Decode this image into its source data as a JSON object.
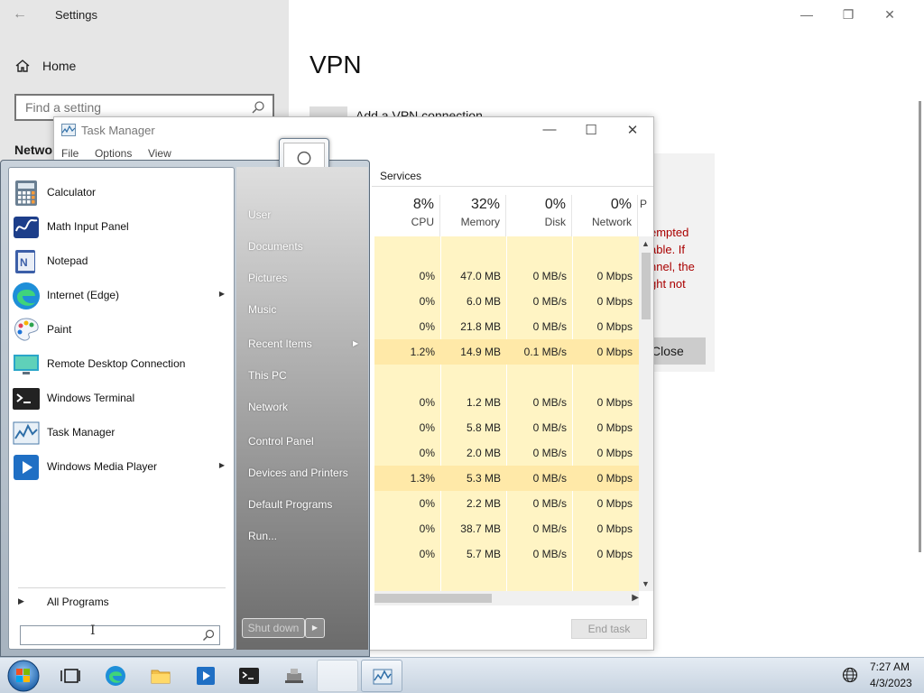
{
  "settings": {
    "title": "Settings",
    "home": "Home",
    "search_placeholder": "Find a setting",
    "section": "Network & Internet",
    "page_title": "VPN",
    "add_vpn": "Add a VPN connection",
    "error_text": "empted\nable. If\nnnel, the\nght not",
    "close_button": "Close"
  },
  "task_manager": {
    "title": "Task Manager",
    "menu": [
      "File",
      "Options",
      "View"
    ],
    "tab_services": "Services",
    "headers": [
      {
        "pct": "8%",
        "name": "CPU"
      },
      {
        "pct": "32%",
        "name": "Memory"
      },
      {
        "pct": "0%",
        "name": "Disk"
      },
      {
        "pct": "0%",
        "name": "Network"
      },
      {
        "pct": "",
        "name": "P"
      }
    ],
    "rows": [
      [
        "",
        "",
        "",
        ""
      ],
      [
        "0%",
        "47.0 MB",
        "0 MB/s",
        "0 Mbps"
      ],
      [
        "0%",
        "6.0 MB",
        "0 MB/s",
        "0 Mbps"
      ],
      [
        "0%",
        "21.8 MB",
        "0 MB/s",
        "0 Mbps"
      ],
      [
        "1.2%",
        "14.9 MB",
        "0.1 MB/s",
        "0 Mbps"
      ],
      [
        "",
        "",
        "",
        ""
      ],
      [
        "0%",
        "1.2 MB",
        "0 MB/s",
        "0 Mbps"
      ],
      [
        "0%",
        "5.8 MB",
        "0 MB/s",
        "0 Mbps"
      ],
      [
        "0%",
        "2.0 MB",
        "0 MB/s",
        "0 Mbps"
      ],
      [
        "1.3%",
        "5.3 MB",
        "0 MB/s",
        "0 Mbps"
      ],
      [
        "0%",
        "2.2 MB",
        "0 MB/s",
        "0 Mbps"
      ],
      [
        "0%",
        "38.7 MB",
        "0 MB/s",
        "0 Mbps"
      ],
      [
        "0%",
        "5.7 MB",
        "0 MB/s",
        "0 Mbps"
      ]
    ],
    "end_task": "End task"
  },
  "start_menu": {
    "programs": [
      {
        "label": "Calculator",
        "icon": "calculator-icon",
        "submenu": false
      },
      {
        "label": "Math Input Panel",
        "icon": "math-input-panel-icon",
        "submenu": false
      },
      {
        "label": "Notepad",
        "icon": "notepad-icon",
        "submenu": false
      },
      {
        "label": "Internet (Edge)",
        "icon": "edge-icon",
        "submenu": true
      },
      {
        "label": "Paint",
        "icon": "paint-icon",
        "submenu": false
      },
      {
        "label": "Remote Desktop Connection",
        "icon": "remote-desktop-icon",
        "submenu": false
      },
      {
        "label": "Windows Terminal",
        "icon": "terminal-icon",
        "submenu": false
      },
      {
        "label": "Task Manager",
        "icon": "task-manager-icon",
        "submenu": false
      },
      {
        "label": "Windows Media Player",
        "icon": "media-player-icon",
        "submenu": true
      }
    ],
    "all_programs": "All Programs",
    "places": [
      {
        "label": "User",
        "submenu": false
      },
      {
        "label": "Documents",
        "submenu": false
      },
      {
        "label": "Pictures",
        "submenu": false
      },
      {
        "label": "Music",
        "submenu": false
      },
      {
        "label": "Recent Items",
        "submenu": true
      },
      {
        "label": "This PC",
        "submenu": false
      },
      {
        "label": "Network",
        "submenu": false
      },
      {
        "label": "Control Panel",
        "submenu": false
      },
      {
        "label": "Devices and Printers",
        "submenu": false
      },
      {
        "label": "Default Programs",
        "submenu": false
      },
      {
        "label": "Run...",
        "submenu": false
      }
    ],
    "shutdown": "Shut down"
  },
  "taskbar": {
    "items": [
      "start-orb",
      "task-view-icon",
      "edge-icon",
      "file-explorer-icon",
      "media-player-icon",
      "terminal-icon",
      "app-icon",
      "blank-window",
      "task-manager-icon"
    ],
    "time": "7:27 AM",
    "date": "4/3/2023"
  }
}
